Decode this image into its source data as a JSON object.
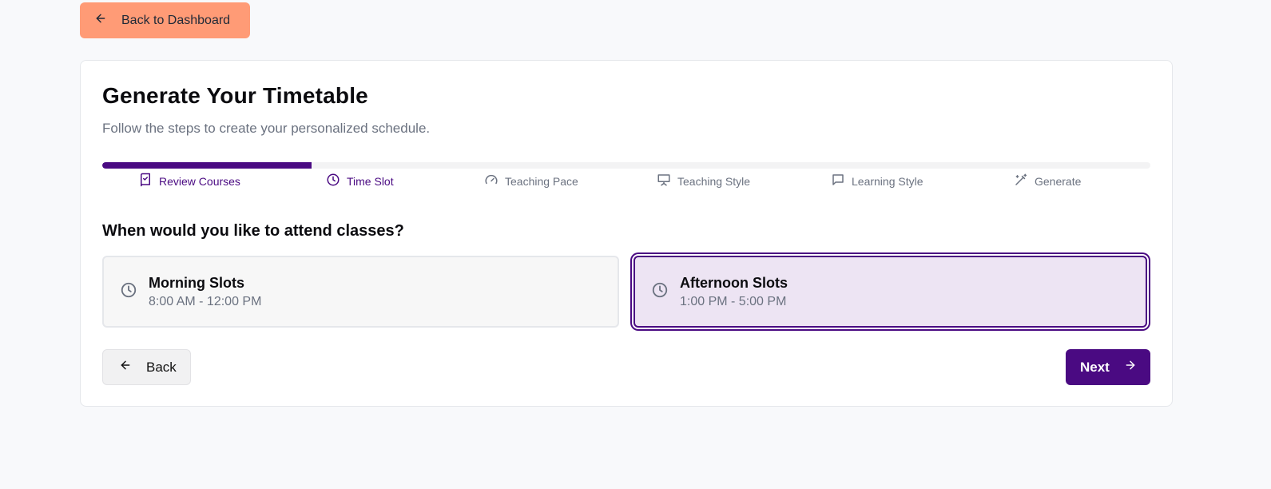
{
  "header": {
    "back_dashboard_label": "Back to Dashboard"
  },
  "card": {
    "title": "Generate Your Timetable",
    "subtitle": "Follow the steps to create your personalized schedule.",
    "progress_fraction": 0.2
  },
  "steps": [
    {
      "label": "Review Courses",
      "icon": "book-check-icon",
      "state": "active"
    },
    {
      "label": "Time Slot",
      "icon": "clock-icon",
      "state": "active"
    },
    {
      "label": "Teaching Pace",
      "icon": "gauge-icon",
      "state": "inactive"
    },
    {
      "label": "Teaching Style",
      "icon": "presentation-icon",
      "state": "inactive"
    },
    {
      "label": "Learning Style",
      "icon": "message-square-icon",
      "state": "inactive"
    },
    {
      "label": "Generate",
      "icon": "wand-icon",
      "state": "inactive"
    }
  ],
  "question": "When would you like to attend classes?",
  "slots": [
    {
      "name": "Morning Slots",
      "time": "8:00 AM - 12:00 PM",
      "selected": false
    },
    {
      "name": "Afternoon Slots",
      "time": "1:00 PM - 5:00 PM",
      "selected": true
    }
  ],
  "nav": {
    "back_label": "Back",
    "next_label": "Next"
  },
  "colors": {
    "accent": "#4a0a82",
    "back_dashboard_bg": "#ff9b76",
    "selected_slot_bg": "#ede4f3"
  }
}
